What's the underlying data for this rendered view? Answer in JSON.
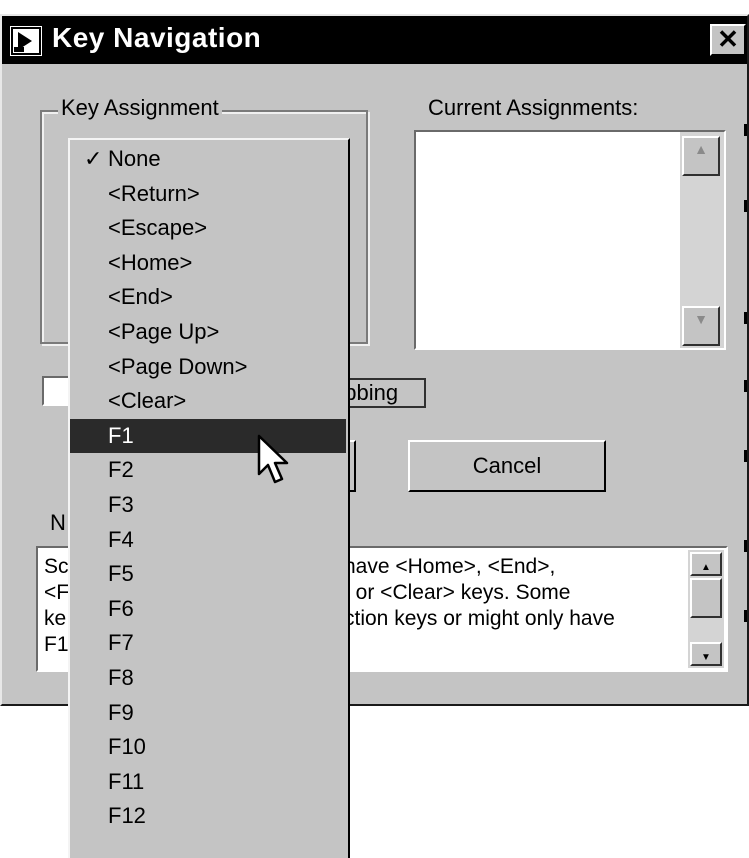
{
  "window": {
    "title": "Key Navigation",
    "close_glyph": "✕",
    "icon": "labview-vi-icon"
  },
  "key_assignment": {
    "group_label": "Key Assignment",
    "selected_value": "F1",
    "options": [
      {
        "label": "None",
        "checked": true
      },
      {
        "label": "<Return>",
        "checked": false
      },
      {
        "label": "<Escape>",
        "checked": false
      },
      {
        "label": "<Home>",
        "checked": false
      },
      {
        "label": "<End>",
        "checked": false
      },
      {
        "label": "<Page Up>",
        "checked": false
      },
      {
        "label": "<Page Down>",
        "checked": false
      },
      {
        "label": "<Clear>",
        "checked": false
      },
      {
        "label": "F1",
        "checked": false,
        "highlighted": true
      },
      {
        "label": "F2",
        "checked": false
      },
      {
        "label": "F3",
        "checked": false
      },
      {
        "label": "F4",
        "checked": false
      },
      {
        "label": "F5",
        "checked": false
      },
      {
        "label": "F6",
        "checked": false
      },
      {
        "label": "F7",
        "checked": false
      },
      {
        "label": "F8",
        "checked": false
      },
      {
        "label": "F9",
        "checked": false
      },
      {
        "label": "F10",
        "checked": false
      },
      {
        "label": "F11",
        "checked": false
      },
      {
        "label": "F12",
        "checked": false
      }
    ],
    "check_glyph": "✓"
  },
  "current_assignments": {
    "label": "Current Assignments:",
    "items": []
  },
  "skip_tabbing": {
    "visible_label": "abbing",
    "checked": false
  },
  "buttons": {
    "cancel_label": "Cancel"
  },
  "notes": {
    "label_visible": "N",
    "lines_visible": [
      {
        "left": "Sc",
        "right": "have <Home>, <End>,"
      },
      {
        "left": "<F",
        "right": ", or <Clear> keys.  Some"
      },
      {
        "left": "ke",
        "right": "ction keys or might only have"
      },
      {
        "left": "F1",
        "right": ""
      }
    ]
  },
  "colors": {
    "dialog_bg": "#c4c4c4",
    "titlebar_bg": "#000000",
    "highlight_bg": "#2a2a2a",
    "list_bg": "#ffffff"
  }
}
